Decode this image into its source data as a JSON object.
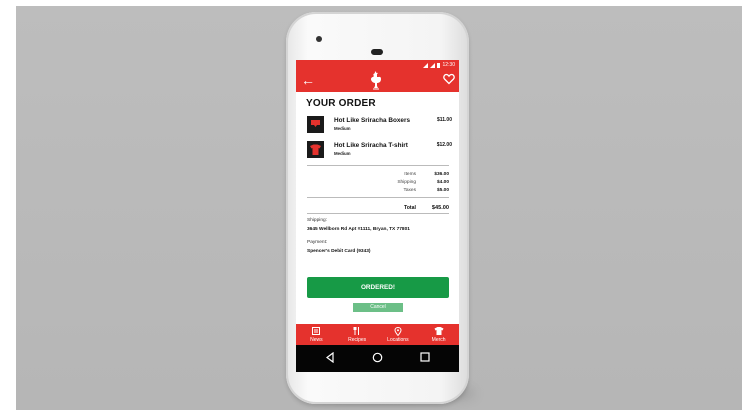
{
  "status_bar": {
    "time": "12:30"
  },
  "app_bar": {
    "back_icon": "arrow-left-icon",
    "logo_icon": "rooster-icon",
    "favorite_icon": "heart-icon"
  },
  "order": {
    "title": "YOUR ORDER",
    "items": [
      {
        "name": "Hot Like Sriracha Boxers",
        "size": "Medium",
        "price": "$11.00"
      },
      {
        "name": "Hot Like Sriracha T-shirt",
        "size": "Medium",
        "price": "$12.00"
      }
    ],
    "summary": [
      {
        "label": "Items",
        "value": "$36.00"
      },
      {
        "label": "Shipping",
        "value": "$4.00"
      },
      {
        "label": "Taxes",
        "value": "$5.00"
      }
    ],
    "total": {
      "label": "Total",
      "value": "$45.00"
    },
    "shipping_label": "Shipping:",
    "shipping_address": "3645 Wellborn Rd Apt #1111, Bryan, TX 77801",
    "payment_label": "Payment:",
    "payment_method": "Spencer's Debit Card (9343)"
  },
  "buttons": {
    "ordered": "ORDERED!",
    "cancel": "Cancel"
  },
  "bottom_nav": [
    {
      "label": "News",
      "icon": "news-icon"
    },
    {
      "label": "Recipes",
      "icon": "utensils-icon"
    },
    {
      "label": "Locations",
      "icon": "location-pin-icon"
    },
    {
      "label": "Merch",
      "icon": "tshirt-icon"
    }
  ],
  "colors": {
    "brand_red": "#e5322d",
    "confirm_green": "#179a46",
    "cancel_green": "#6cbf87"
  }
}
